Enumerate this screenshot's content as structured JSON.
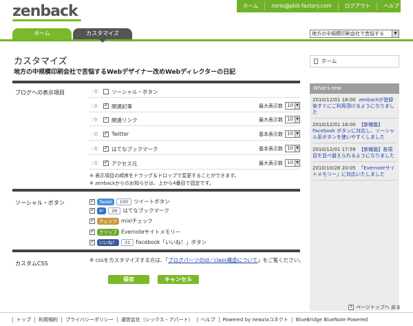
{
  "header": {
    "logo": "zenback",
    "nav": [
      "ホーム",
      "norio@plot-factory.com",
      "ログアウト",
      "ヘルプ"
    ]
  },
  "tabs": [
    {
      "label": "ホーム"
    },
    {
      "label": "カスタマイズ"
    }
  ],
  "blog_select": {
    "selected": "地方の中規模印刷会社で苦悩する"
  },
  "main": {
    "title": "カスタマイズ",
    "blog_title": "地方の中規模印刷会社で苦悩するWebデザイナー改めWebディレクターの日記"
  },
  "display_items": {
    "section_label": "ブログへの表示項目",
    "rows": [
      {
        "label": "ソーシャル・ボタン",
        "checked": false,
        "right_label": "",
        "count": ""
      },
      {
        "label": "関連記事",
        "checked": true,
        "right_label": "最大表示数",
        "count": "10"
      },
      {
        "label": "関連リンク",
        "checked": true,
        "right_label": "最大表示数",
        "count": "10"
      },
      {
        "label": "Twitter",
        "checked": true,
        "right_label": "基本表示数",
        "count": "10"
      },
      {
        "label": "はてなブックマーク",
        "checked": true,
        "right_label": "基本表示数",
        "count": "10"
      },
      {
        "label": "アクセス元",
        "checked": true,
        "right_label": "最大表示数",
        "count": "10"
      }
    ],
    "notes": [
      "※ 表示項目の順序をドラッグ＆ドロップで変更することができます。",
      "※ zenbackからのお知らせは、上から4番目で固定です。"
    ]
  },
  "social": {
    "section_label": "ソーシャル・ボタン",
    "buttons": [
      {
        "badge": "Tweet",
        "count": "100",
        "text": "ツイートボタン",
        "color": "#4a8fd6"
      },
      {
        "badge": "B!",
        "count": "26",
        "text": "はてなブックマーク",
        "color": "#2c6ebd"
      },
      {
        "badge": "チェック",
        "count": "",
        "text": "mixiチェック",
        "color": "#c89a3a"
      },
      {
        "badge": "クリップ",
        "count": "",
        "text": "Evernoteサイトメモリー",
        "color": "#6aaa2a"
      },
      {
        "badge": "いいね！",
        "count": "31",
        "text": "Facebook「いいね！」ボタン",
        "color": "#3b5998"
      }
    ]
  },
  "css": {
    "section_label": "カスタムCSS",
    "note_prefix": "※ cssをカスタマイズする方は、「",
    "note_link": "ブログパーツのid／class構造について",
    "note_suffix": "」をご覧ください。"
  },
  "actions": {
    "save": "保存",
    "cancel": "キャンセル"
  },
  "sidebar": {
    "home": "ホーム",
    "whatsnew_title": "What's new",
    "news": [
      {
        "date": "2010/12/01 18:00",
        "text": "zenbackが登録後すぐにご利用頂けるようになりました"
      },
      {
        "date": "2010/12/01 18:00",
        "text": "【新機能】Facebook ボタンに対応し、ソーシャル系ボタンを使いやすくしました"
      },
      {
        "date": "2010/12/01 17:59",
        "text": "【新機能】各項目を並べ替えられるようになりました"
      },
      {
        "date": "2010/10/28 20:05",
        "text": "「Evernoteサイトメモリー」に対応いたしました"
      }
    ]
  },
  "footer": {
    "pagetop": "ページトップへ 戻る",
    "links": [
      "トップ",
      "利用規約",
      "プライバシーポリシー",
      "運営会社（シックス・アパート）",
      "ヘルプ",
      "Powered by newziaコネクト",
      "BlueBridge BlueNote Powered"
    ]
  },
  "colors": {
    "accent": "#7ab929",
    "dark": "#444444",
    "link": "#1a3fa8"
  }
}
